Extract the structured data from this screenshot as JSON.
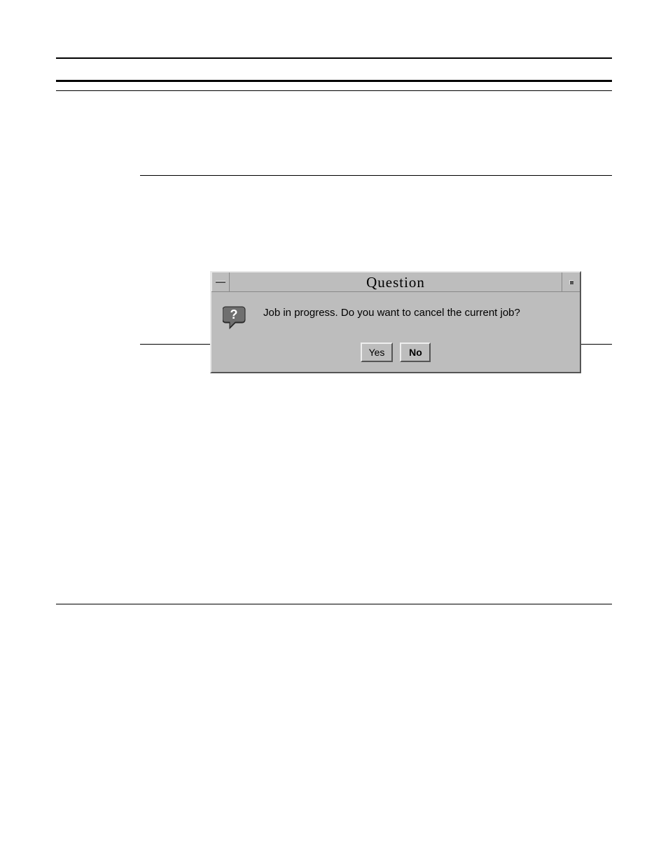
{
  "dialog": {
    "title": "Question",
    "icon": "question-icon",
    "message": "Job in progress. Do you want to cancel the current job?",
    "buttons": {
      "yes": "Yes",
      "no": "No"
    }
  }
}
